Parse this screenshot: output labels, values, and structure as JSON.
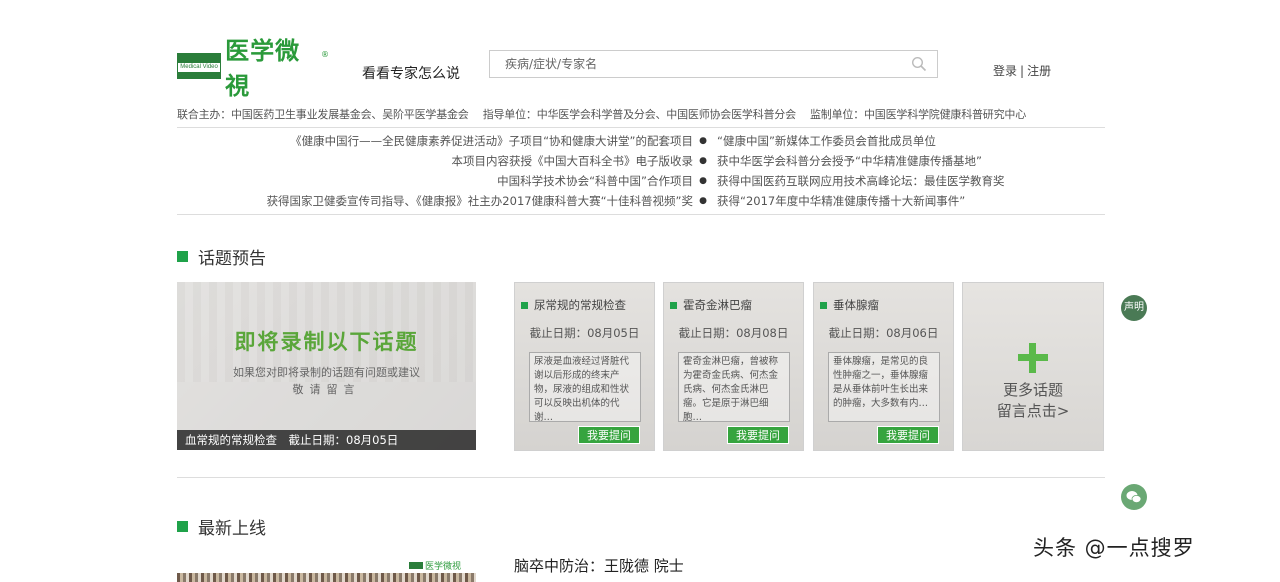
{
  "header": {
    "logo_text": "医学微視",
    "logo_en": "Medical Video",
    "logo_reg": "®",
    "slogan": "看看专家怎么说",
    "search_placeholder": "疾病/症状/专家名",
    "login": "登录",
    "separator": "|",
    "register": "注册"
  },
  "sponsors": "联合主办：中国医药卫生事业发展基金会、吴阶平医学基金会　 指导单位：中华医学会科学普及分会、中国医师协会医学科普分会　 监制单位：中国医学科学院健康科普研究中心",
  "honors": [
    {
      "left": "《健康中国行——全民健康素养促进活动》子项目“协和健康大讲堂”的配套项目",
      "dot": "●",
      "right": "“健康中国”新媒体工作委员会首批成员单位"
    },
    {
      "left": "本项目内容获授《中国大百科全书》电子版收录",
      "dot": "●",
      "right": "获中华医学会科普分会授予“中华精准健康传播基地”"
    },
    {
      "left": "中国科学技术协会“科普中国”合作项目",
      "dot": "●",
      "right": "获得中国医药互联网应用技术高峰论坛：最佳医学教育奖"
    },
    {
      "left": "获得国家卫健委宣传司指导、《健康报》社主办2017健康科普大赛“十佳科普视频”奖",
      "dot": "●",
      "right": "获得“2017年度中华精准健康传播十大新闻事件”"
    }
  ],
  "topics_section": {
    "title": "话题预告",
    "banner": {
      "heading": "即将录制以下话题",
      "sub1": "如果您对即将录制的话题有问题或建议",
      "sub2": "敬请留言",
      "caption": "血常规的常规检查　截止日期：08月05日"
    },
    "cards": [
      {
        "title": "尿常规的常规检查",
        "deadline": "截止日期：08月05日",
        "desc": "尿液是血液经过肾脏代谢以后形成的终末产物，尿液的组成和性状可以反映出机体的代谢…",
        "button": "我要提问"
      },
      {
        "title": "霍奇金淋巴瘤",
        "deadline": "截止日期：08月08日",
        "desc": "霍奇金淋巴瘤，曾被称为霍奇金氏病、何杰金氏病、何杰金氏淋巴瘤。它是原于淋巴细胞…",
        "button": "我要提问"
      },
      {
        "title": "垂体腺瘤",
        "deadline": "截止日期：08月06日",
        "desc": "垂体腺瘤，是常见的良性肿瘤之一，垂体腺瘤是从垂体前叶生长出来的肿瘤，大多数有内…",
        "button": "我要提问"
      }
    ],
    "more": {
      "line1": "更多话题",
      "line2": "留言点击>"
    }
  },
  "side": {
    "statement": "声明"
  },
  "latest_section": {
    "title": "最新上线",
    "item_title": "脑卒中防治：王陇德 院士",
    "thumb_brand": "医学微视"
  },
  "watermark": "头条 @一点搜罗",
  "colors": {
    "accent": "#1fa24a",
    "button": "#36a43e"
  }
}
